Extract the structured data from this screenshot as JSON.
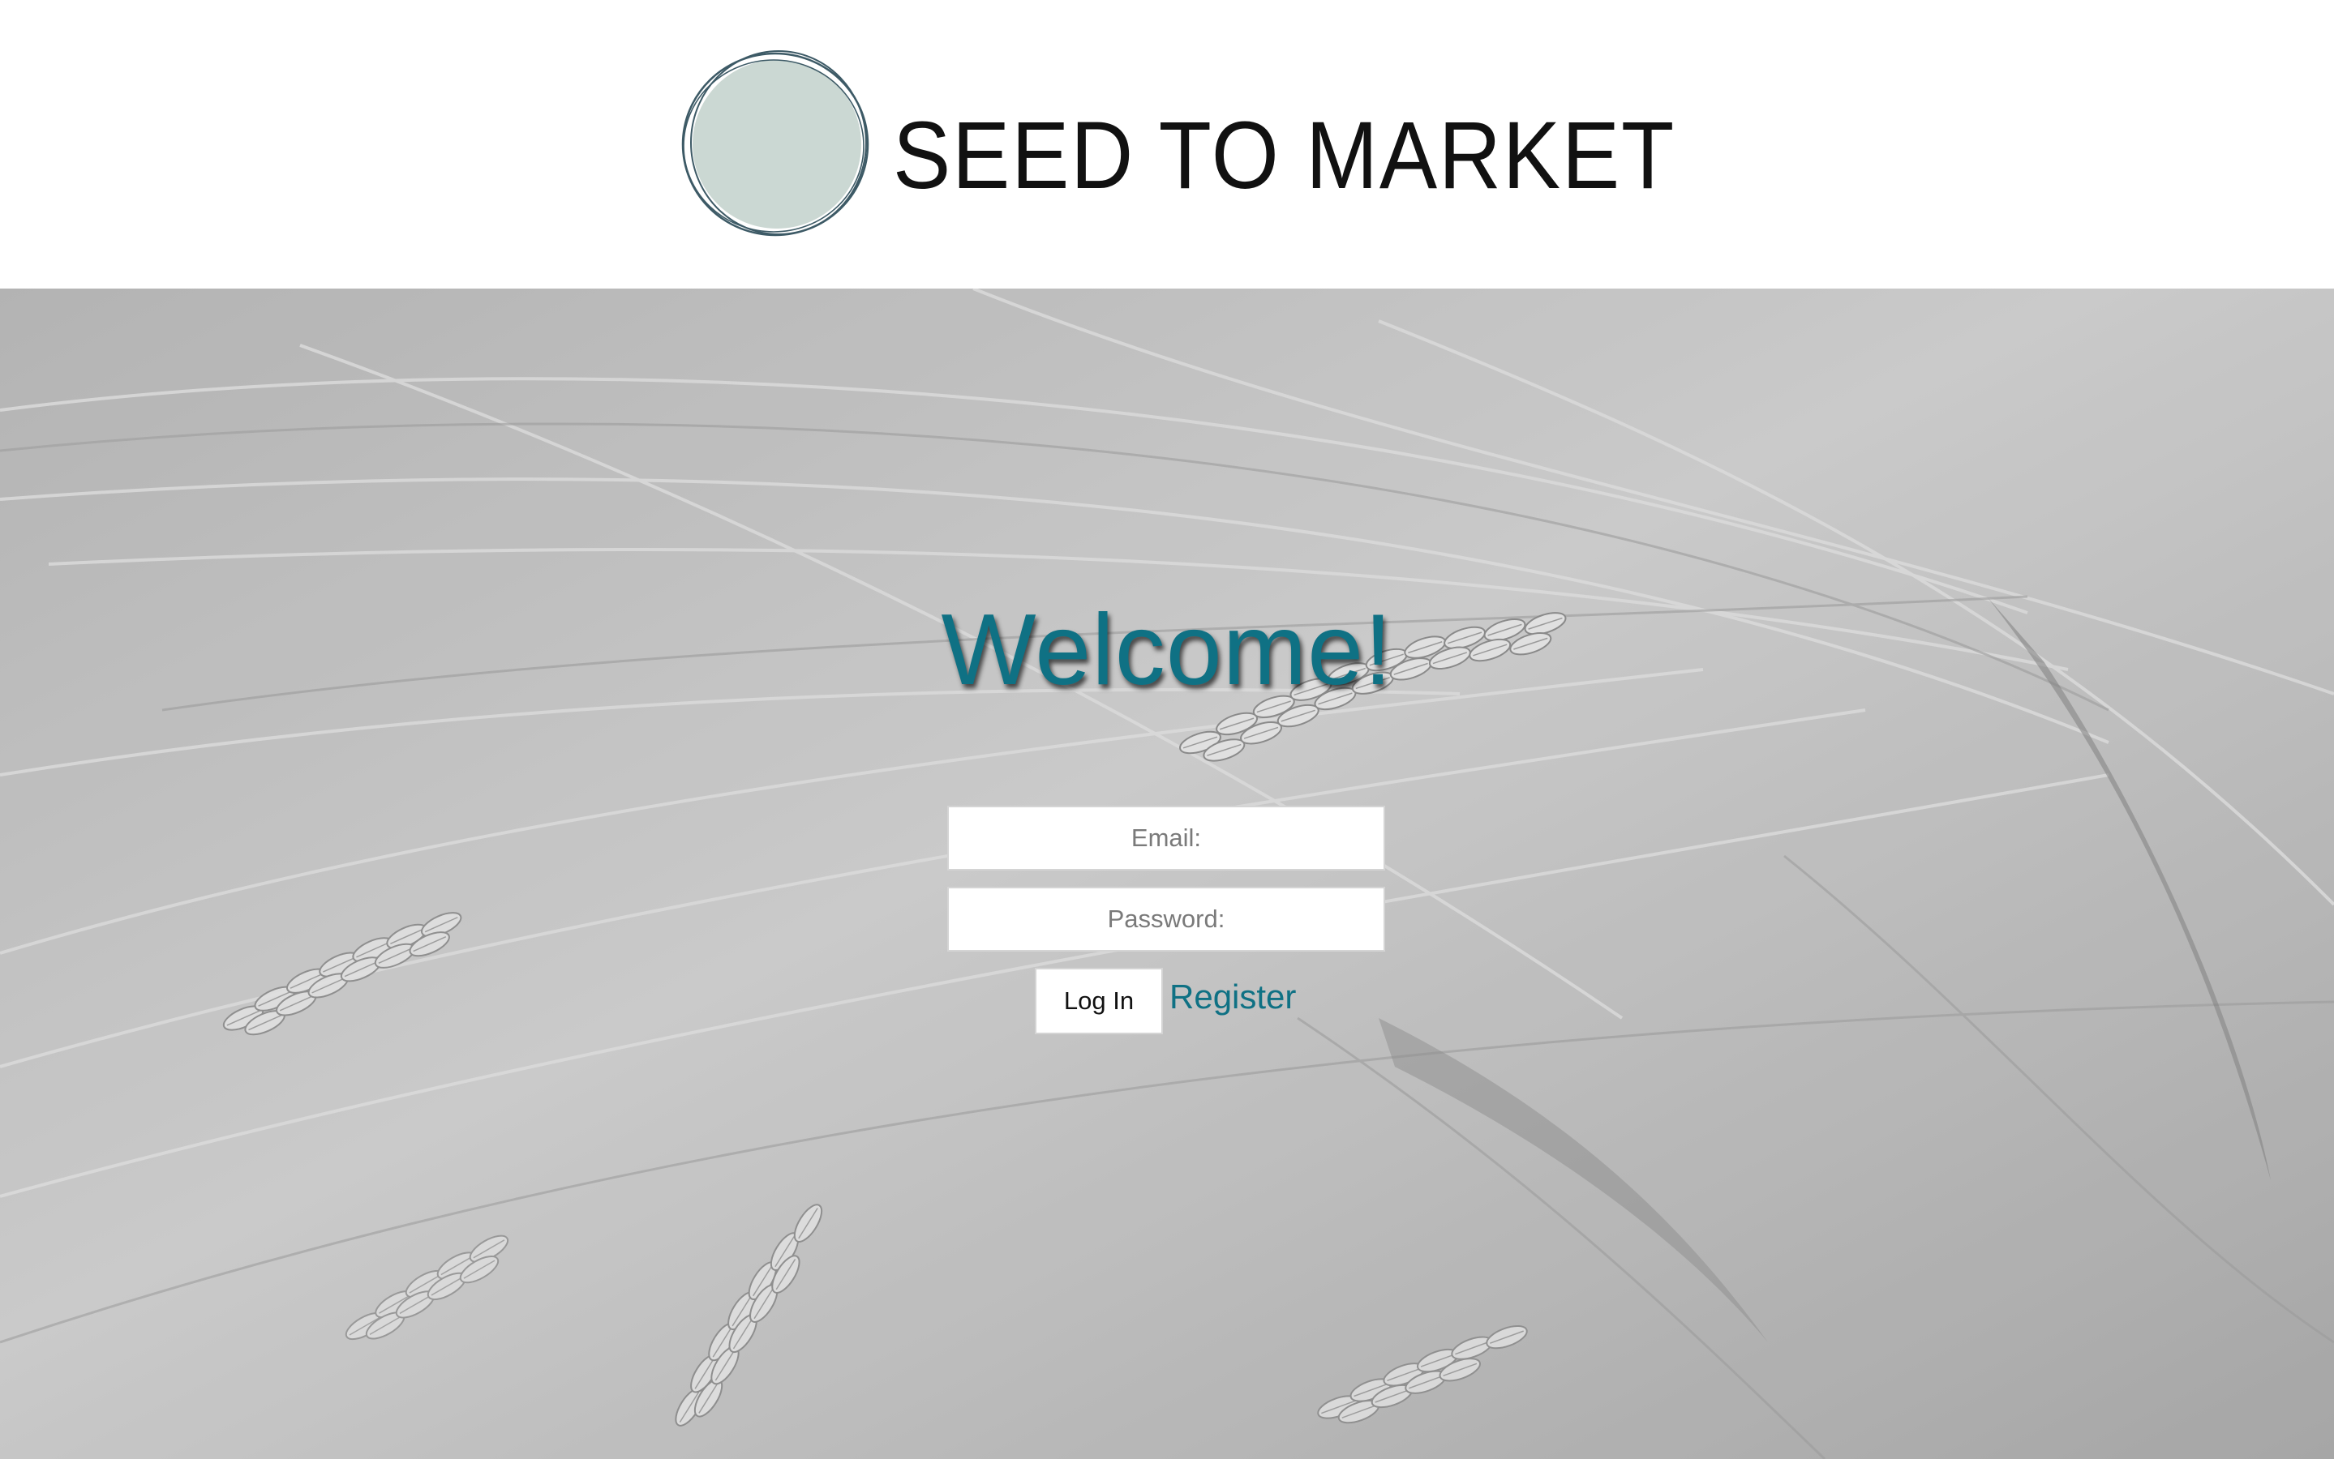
{
  "brand": {
    "name": "SEED TO MARKET",
    "logo_circle_fill": "#cbd8d3",
    "logo_circle_stroke": "#3d5a66",
    "logo_text_color": "#111111"
  },
  "login": {
    "heading": "Welcome!",
    "email_placeholder": "Email:",
    "password_placeholder": "Password:",
    "login_button_label": "Log In",
    "register_link_label": "Register"
  },
  "colors": {
    "accent": "#0f7184",
    "background_tone": "#b3b3b3",
    "field_background": "#ffffff"
  },
  "background": {
    "description_icon": "wheat-photo"
  }
}
